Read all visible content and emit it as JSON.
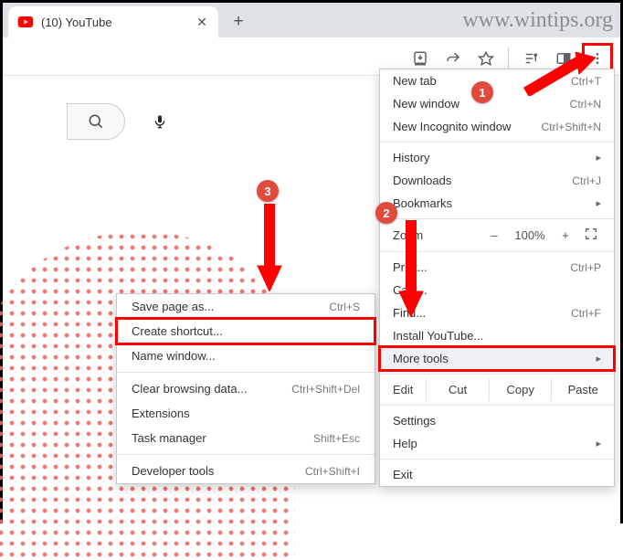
{
  "watermark": "www.wintips.org",
  "tab": {
    "title": "(10) YouTube"
  },
  "callouts": {
    "one": "1",
    "two": "2",
    "three": "3"
  },
  "menu": {
    "new_tab": "New tab",
    "new_tab_sc": "Ctrl+T",
    "new_window": "New window",
    "new_window_sc": "Ctrl+N",
    "new_incognito": "New Incognito window",
    "new_incognito_sc": "Ctrl+Shift+N",
    "history": "History",
    "downloads": "Downloads",
    "downloads_sc": "Ctrl+J",
    "bookmarks": "Bookmarks",
    "zoom": "Zoom",
    "zoom_minus": "–",
    "zoom_pct": "100%",
    "zoom_plus": "+",
    "print": "Print...",
    "print_sc": "Ctrl+P",
    "cast": "Cast...",
    "find": "Find...",
    "find_sc": "Ctrl+F",
    "install": "Install YouTube...",
    "more_tools": "More tools",
    "edit": "Edit",
    "cut": "Cut",
    "copy": "Copy",
    "paste": "Paste",
    "settings": "Settings",
    "help": "Help",
    "exit": "Exit"
  },
  "submenu": {
    "save_as": "Save page as...",
    "save_as_sc": "Ctrl+S",
    "create_shortcut": "Create shortcut...",
    "name_window": "Name window...",
    "clear_data": "Clear browsing data...",
    "clear_data_sc": "Ctrl+Shift+Del",
    "extensions": "Extensions",
    "task_manager": "Task manager",
    "task_manager_sc": "Shift+Esc",
    "dev_tools": "Developer tools",
    "dev_tools_sc": "Ctrl+Shift+I"
  }
}
